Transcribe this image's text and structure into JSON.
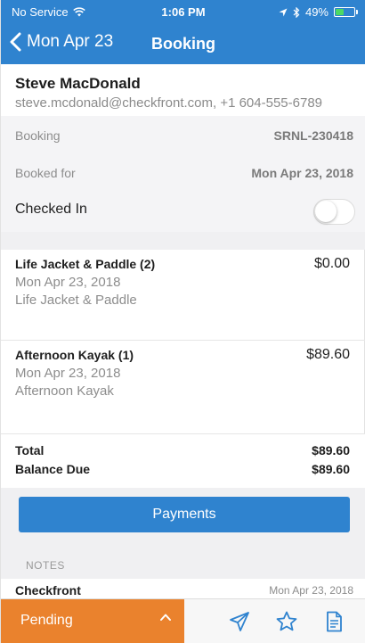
{
  "status_bar": {
    "carrier": "No Service",
    "time": "1:06 PM",
    "battery": "49%",
    "battery_level": 0.49,
    "icons": [
      "wifi-icon",
      "location-arrow-icon",
      "bluetooth-icon",
      "battery-icon"
    ]
  },
  "nav": {
    "back_label": "Mon Apr 23",
    "title": "Booking"
  },
  "customer": {
    "name": "Steve MacDonald",
    "contact": "steve.mcdonald@checkfront.com, +1 604-555-6789"
  },
  "booking_info": {
    "booking_label": "Booking",
    "booking_value": "SRNL-230418",
    "booked_for_label": "Booked for",
    "booked_for_value": "Mon Apr 23, 2018",
    "checked_in_label": "Checked In",
    "checked_in": false
  },
  "items": [
    {
      "title": "Life Jacket & Paddle (2)",
      "price": "$0.00",
      "date": "Mon Apr 23, 2018",
      "desc": "Life Jacket & Paddle"
    },
    {
      "title": "Afternoon Kayak (1)",
      "price": "$89.60",
      "date": "Mon Apr 23, 2018",
      "desc": "Afternoon Kayak"
    }
  ],
  "totals": {
    "total_label": "Total",
    "total_value": "$89.60",
    "balance_label": "Balance Due",
    "balance_value": "$89.60"
  },
  "payments_button": "Payments",
  "notes": {
    "section_label": "NOTES",
    "entries": [
      {
        "author": "Checkfront",
        "date": "Mon Apr 23, 2018"
      }
    ]
  },
  "bottom_bar": {
    "status_label": "Pending",
    "icons": [
      "send-icon",
      "star-icon",
      "document-icon"
    ]
  },
  "colors": {
    "brand_blue": "#2f83cf",
    "status_orange": "#ea822d"
  }
}
